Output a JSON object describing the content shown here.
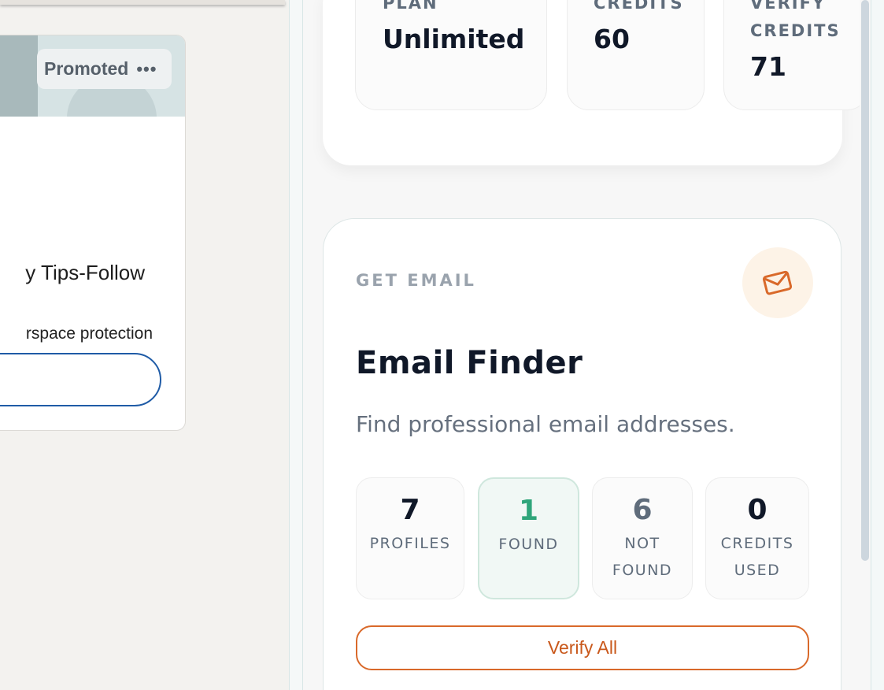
{
  "left_feed": {
    "ad": {
      "promoted_label": "Promoted",
      "more_glyph": "•••",
      "title_fragment": "y Tips-Follow",
      "subtitle_fragment": "rspace protection"
    }
  },
  "plan_stats": {
    "plan": {
      "label": "PLAN",
      "value": "Unlimited"
    },
    "credits": {
      "label": "CREDITS",
      "value": "60"
    },
    "verify_credits": {
      "label_line1": "VERIFY",
      "label_line2": "CREDITS",
      "value": "71"
    }
  },
  "email_finder": {
    "eyebrow": "GET EMAIL",
    "icon": "mail-icon",
    "title": "Email Finder",
    "description": "Find professional email addresses.",
    "metrics": [
      {
        "value": "7",
        "label": "PROFILES"
      },
      {
        "value": "1",
        "label": "FOUND"
      },
      {
        "value": "6",
        "label_line1": "NOT",
        "label_line2": "FOUND"
      },
      {
        "value": "0",
        "label_line1": "CREDITS",
        "label_line2": "USED"
      }
    ],
    "verify_button": "Verify All"
  },
  "colors": {
    "accent_orange": "#c9581b",
    "found_green": "#2fa57a",
    "not_found_gray": "#5f6c7b",
    "linkedin_blue": "#1f5ba6"
  }
}
